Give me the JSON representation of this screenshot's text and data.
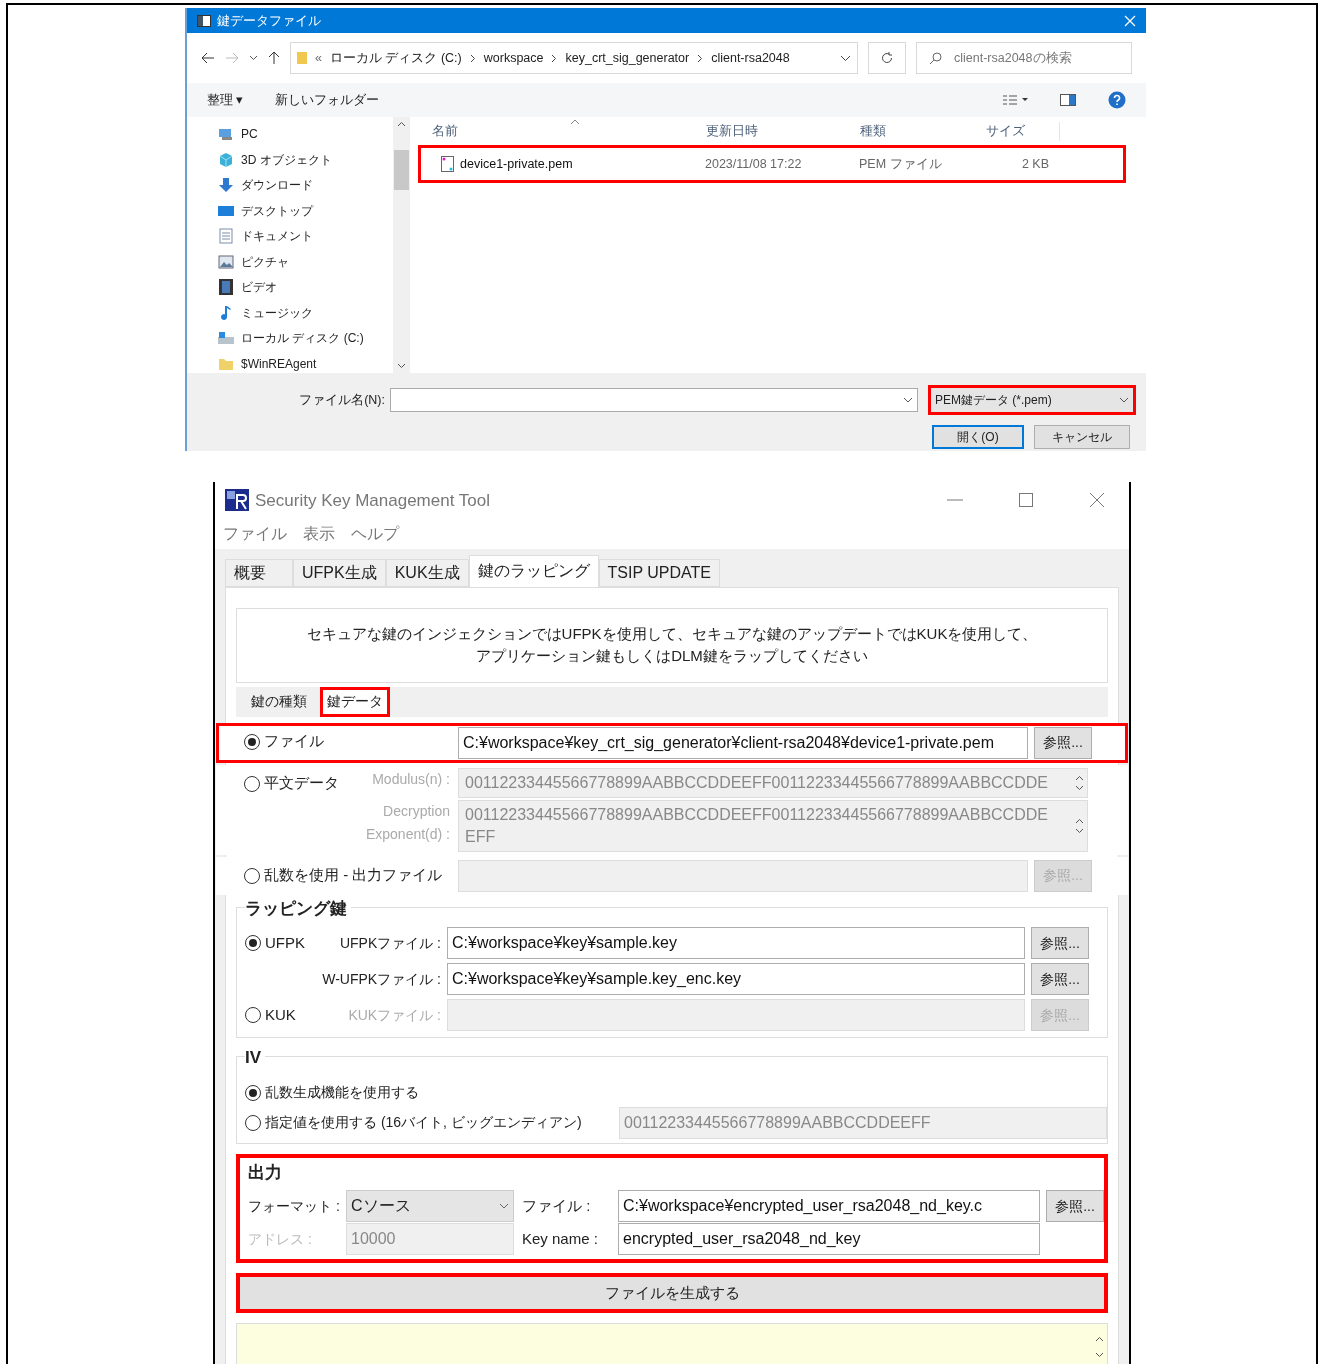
{
  "dialog": {
    "title": "鍵データファイル",
    "path_overflow": "«",
    "path": [
      "ローカル ディスク (C:)",
      "workspace",
      "key_crt_sig_generator",
      "client-rsa2048"
    ],
    "search": {
      "placeholder": "client-rsa2048の検索"
    },
    "toolbar": {
      "organize": "整理 ▾",
      "new_folder": "新しいフォルダー"
    },
    "sidebar": [
      {
        "kind": "pc",
        "label": "PC"
      },
      {
        "kind": "objects",
        "label": "3D オブジェクト"
      },
      {
        "kind": "download",
        "label": "ダウンロード"
      },
      {
        "kind": "desktop",
        "label": "デスクトップ"
      },
      {
        "kind": "documents",
        "label": "ドキュメント"
      },
      {
        "kind": "pictures",
        "label": "ピクチャ"
      },
      {
        "kind": "videos",
        "label": "ビデオ"
      },
      {
        "kind": "music",
        "label": "ミュージック"
      },
      {
        "kind": "drive",
        "label": "ローカル ディスク (C:)"
      },
      {
        "kind": "folder",
        "label": "$WinREAgent"
      }
    ],
    "columns": [
      "名前",
      "更新日時",
      "種類",
      "サイズ"
    ],
    "rows": [
      {
        "name": "device1-private.pem",
        "date": "2023/11/08 17:22",
        "type": "PEM ファイル",
        "size": "2 KB",
        "highlighted": true
      }
    ],
    "filename_label": "ファイル名(N):",
    "filter": {
      "value": "PEM鍵データ (*.pem)",
      "highlighted": true
    },
    "open_button": "開く(O)",
    "cancel_button": "キャンセル"
  },
  "tool": {
    "title": "Security Key Management Tool",
    "menu": [
      "ファイル",
      "表示",
      "ヘルプ"
    ],
    "tabs": [
      {
        "label": "概要",
        "selected": false
      },
      {
        "label": "UFPK生成",
        "selected": false
      },
      {
        "label": "KUK生成",
        "selected": false
      },
      {
        "label": "鍵のラッピング",
        "selected": true
      },
      {
        "label": "TSIP UPDATE",
        "selected": false
      }
    ],
    "description": [
      "セキュアな鍵のインジェクションではUFPKを使用して、セキュアな鍵のアップデートではKUKを使用して、",
      "アプリケーション鍵もしくはDLM鍵をラップしてください"
    ],
    "subtabs": [
      {
        "label": "鍵の種類",
        "selected": false,
        "highlighted": false
      },
      {
        "label": "鍵データ",
        "selected": true,
        "highlighted": true
      }
    ],
    "key_source": [
      {
        "kind": "file",
        "label": "ファイル",
        "selected": true,
        "highlighted": true,
        "value": "C:¥workspace¥key_crt_sig_generator¥client-rsa2048¥device1-private.pem",
        "button": "参照..."
      },
      {
        "kind": "plain",
        "label": "平文データ",
        "selected": false,
        "highlighted": false,
        "fields": [
          {
            "label": "Modulus(n) :",
            "lines": [
              "00112233445566778899AABBCCDDEEFF00112233445566778899AABBCCDDE"
            ]
          },
          {
            "label": "Decryption Exponent(d) :",
            "lines": [
              "00112233445566778899AABBCCDDEEFF00112233445566778899AABBCCDDE",
              "EFF"
            ]
          }
        ]
      },
      {
        "kind": "random",
        "label": "乱数を使用 - 出力ファイル",
        "selected": false,
        "highlighted": false,
        "button": "参照..."
      }
    ],
    "wrapping": {
      "title": "ラッピング鍵",
      "options": [
        {
          "label": "UFPK",
          "selected": true,
          "fields": [
            {
              "label": "UFPKファイル :",
              "value": "C:¥workspace¥key¥sample.key",
              "button": "参照..."
            },
            {
              "label": "W-UFPKファイル :",
              "value": "C:¥workspace¥key¥sample.key_enc.key",
              "button": "参照..."
            }
          ]
        },
        {
          "label": "KUK",
          "selected": false,
          "fields": [
            {
              "label": "KUKファイル :",
              "button": "参照..."
            }
          ]
        }
      ]
    },
    "iv": {
      "title": "IV",
      "options": [
        {
          "label": "乱数生成機能を使用する",
          "selected": true
        },
        {
          "label": "指定値を使用する (16バイト, ビッグエンディアン)",
          "selected": false,
          "value": "00112233445566778899AABBCCDDEEFF"
        }
      ]
    },
    "output": {
      "title": "出力",
      "highlighted": true,
      "format_label": "フォーマット :",
      "format_value": "Cソース",
      "address_label": "アドレス :",
      "address_value": "10000",
      "address_disabled": true,
      "file_label": "ファイル :",
      "file_value": "C:¥workspace¥encrypted_user_rsa2048_nd_key.c",
      "button": "参照...",
      "keyname_label": "Key name :",
      "keyname_value": "encrypted_user_rsa2048_nd_key"
    },
    "generate": {
      "label": "ファイルを生成する",
      "highlighted": true
    }
  }
}
